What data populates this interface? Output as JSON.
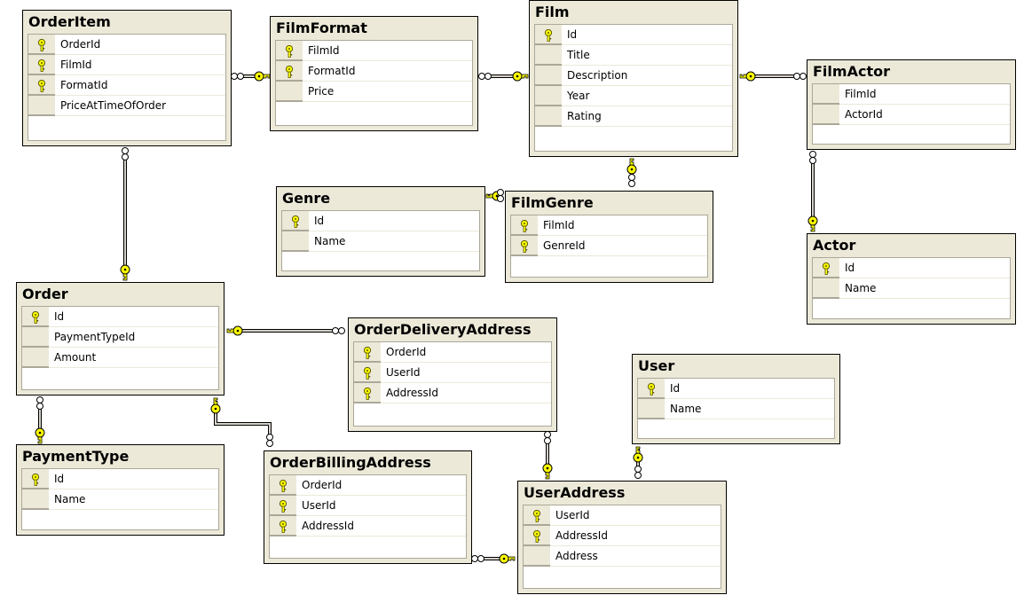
{
  "diagram": {
    "tables": [
      {
        "name": "OrderItem",
        "columns": [
          {
            "name": "OrderId",
            "pk": true
          },
          {
            "name": "FilmId",
            "pk": true
          },
          {
            "name": "FormatId",
            "pk": true
          },
          {
            "name": "PriceAtTimeOfOrder",
            "pk": false
          }
        ]
      },
      {
        "name": "FilmFormat",
        "columns": [
          {
            "name": "FilmId",
            "pk": true
          },
          {
            "name": "FormatId",
            "pk": true
          },
          {
            "name": "Price",
            "pk": false
          }
        ]
      },
      {
        "name": "Film",
        "columns": [
          {
            "name": "Id",
            "pk": true
          },
          {
            "name": "Title",
            "pk": false
          },
          {
            "name": "Description",
            "pk": false
          },
          {
            "name": "Year",
            "pk": false
          },
          {
            "name": "Rating",
            "pk": false
          }
        ]
      },
      {
        "name": "FilmActor",
        "columns": [
          {
            "name": "FilmId",
            "pk": false
          },
          {
            "name": "ActorId",
            "pk": false
          }
        ]
      },
      {
        "name": "Genre",
        "columns": [
          {
            "name": "Id",
            "pk": true
          },
          {
            "name": "Name",
            "pk": false
          }
        ]
      },
      {
        "name": "FilmGenre",
        "columns": [
          {
            "name": "FilmId",
            "pk": true
          },
          {
            "name": "GenreId",
            "pk": true
          }
        ]
      },
      {
        "name": "Actor",
        "columns": [
          {
            "name": "Id",
            "pk": true
          },
          {
            "name": "Name",
            "pk": false
          }
        ]
      },
      {
        "name": "Order",
        "columns": [
          {
            "name": "Id",
            "pk": true
          },
          {
            "name": "PaymentTypeId",
            "pk": false
          },
          {
            "name": "Amount",
            "pk": false
          }
        ]
      },
      {
        "name": "OrderDeliveryAddress",
        "columns": [
          {
            "name": "OrderId",
            "pk": true
          },
          {
            "name": "UserId",
            "pk": true
          },
          {
            "name": "AddressId",
            "pk": true
          }
        ]
      },
      {
        "name": "User",
        "columns": [
          {
            "name": "Id",
            "pk": true
          },
          {
            "name": "Name",
            "pk": false
          }
        ]
      },
      {
        "name": "PaymentType",
        "columns": [
          {
            "name": "Id",
            "pk": true
          },
          {
            "name": "Name",
            "pk": false
          }
        ]
      },
      {
        "name": "OrderBillingAddress",
        "columns": [
          {
            "name": "OrderId",
            "pk": true
          },
          {
            "name": "UserId",
            "pk": true
          },
          {
            "name": "AddressId",
            "pk": true
          }
        ]
      },
      {
        "name": "UserAddress",
        "columns": [
          {
            "name": "UserId",
            "pk": true
          },
          {
            "name": "AddressId",
            "pk": true
          },
          {
            "name": "Address",
            "pk": false
          }
        ]
      }
    ],
    "relationships": [
      {
        "one": "FilmFormat",
        "many": "OrderItem"
      },
      {
        "one": "Film",
        "many": "FilmFormat"
      },
      {
        "one": "Film",
        "many": "FilmActor"
      },
      {
        "one": "Film",
        "many": "FilmGenre"
      },
      {
        "one": "Genre",
        "many": "FilmGenre"
      },
      {
        "one": "Actor",
        "many": "FilmActor"
      },
      {
        "one": "Order",
        "many": "OrderItem"
      },
      {
        "one": "Order",
        "many": "OrderDeliveryAddress"
      },
      {
        "one": "PaymentType",
        "many": "Order"
      },
      {
        "one": "Order",
        "many": "OrderBillingAddress"
      },
      {
        "one": "UserAddress",
        "many": "OrderDeliveryAddress"
      },
      {
        "one": "UserAddress",
        "many": "OrderBillingAddress"
      },
      {
        "one": "User",
        "many": "UserAddress"
      }
    ],
    "colors": {
      "background": "#ffffff",
      "table_fill": "#ece9d8",
      "grid_border": "#aca899",
      "key": "#ffff00",
      "line": "#000000"
    }
  }
}
